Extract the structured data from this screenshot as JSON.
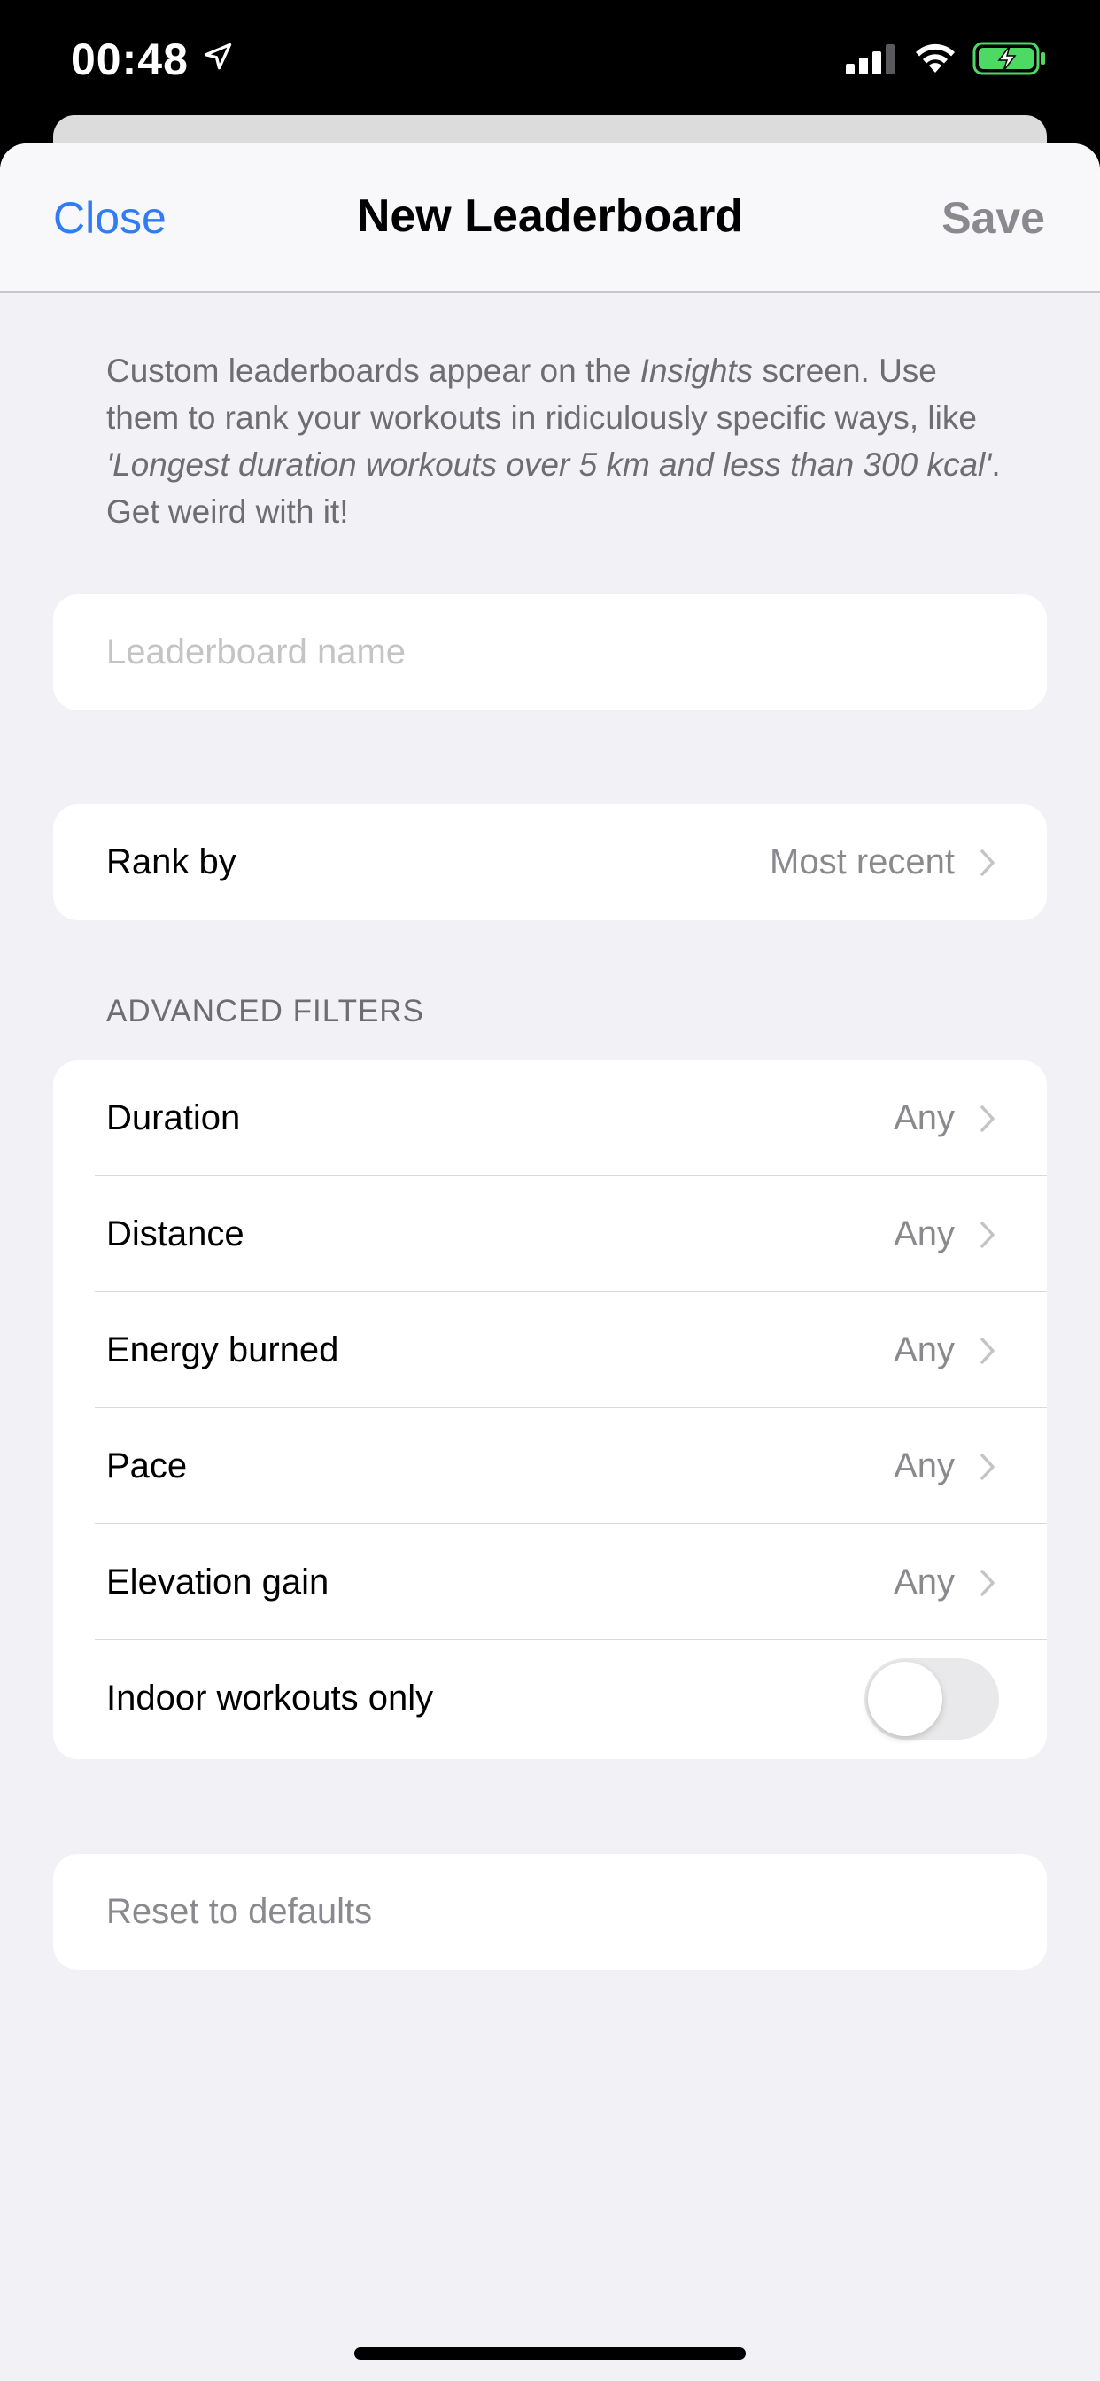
{
  "status_bar": {
    "time": "00:48",
    "icons": [
      "location-arrow-icon",
      "cellular-signal-icon",
      "wifi-icon",
      "battery-charging-icon"
    ],
    "battery_color": "#4cd964"
  },
  "nav": {
    "close_label": "Close",
    "title": "New Leaderboard",
    "save_label": "Save"
  },
  "intro": {
    "part1": "Custom leaderboards appear on the ",
    "insights": "Insights",
    "part2": " screen. Use them to rank your workouts in ridiculously specific ways, like ",
    "example": "'Longest duration workouts over 5 km and less than 300 kcal'",
    "part3": ". Get weird with it!"
  },
  "name_field": {
    "placeholder": "Leaderboard name",
    "value": ""
  },
  "rank": {
    "label": "Rank by",
    "value": "Most recent"
  },
  "advanced_filters": {
    "header": "ADVANCED FILTERS",
    "rows": [
      {
        "label": "Duration",
        "value": "Any"
      },
      {
        "label": "Distance",
        "value": "Any"
      },
      {
        "label": "Energy burned",
        "value": "Any"
      },
      {
        "label": "Pace",
        "value": "Any"
      },
      {
        "label": "Elevation gain",
        "value": "Any"
      }
    ],
    "indoor": {
      "label": "Indoor workouts only",
      "enabled": false
    }
  },
  "reset": {
    "label": "Reset to defaults"
  },
  "colors": {
    "accent": "#2f7cf6",
    "background": "#f1f1f6",
    "secondary_text": "#8a8a8e"
  }
}
